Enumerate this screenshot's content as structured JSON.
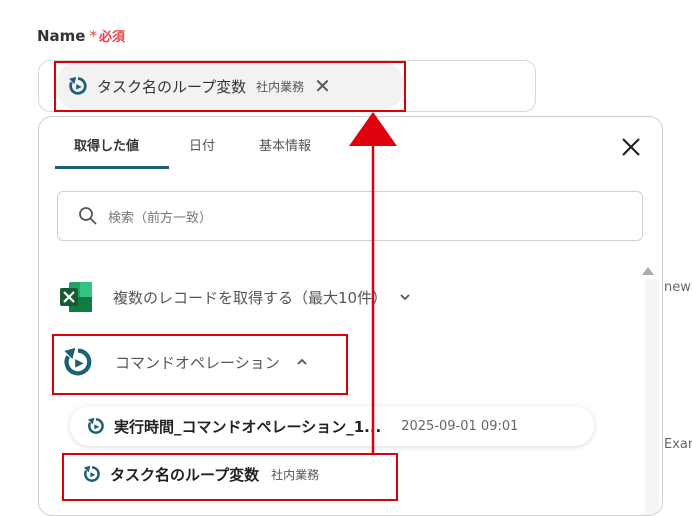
{
  "field": {
    "label": "Name",
    "required_star": "*",
    "required_text": "必須",
    "chip": {
      "label": "タスク名のループ変数",
      "sub": "社内業務"
    }
  },
  "panel": {
    "tabs": [
      {
        "label": "取得した値",
        "active": true
      },
      {
        "label": "日付",
        "active": false
      },
      {
        "label": "基本情報",
        "active": false
      }
    ],
    "search_placeholder": "検索（前方一致）",
    "groups": [
      {
        "label": "複数のレコードを取得する（最大10件）",
        "icon": "excel-icon",
        "expanded": false
      },
      {
        "label": "コマンドオペレーション",
        "icon": "refresh-icon",
        "expanded": true
      }
    ],
    "items": [
      {
        "label": "実行時間_コマンドオペレーション_1...",
        "value": "2025-09-01 09:01"
      },
      {
        "label": "タスク名のループ変数",
        "sub": "社内業務"
      }
    ]
  },
  "background_text": [
    "new",
    "Exar"
  ],
  "colors": {
    "accent": "#1d5f75",
    "required": "#e8414d",
    "highlight": "#d9000c",
    "excel": "#1d7044"
  }
}
